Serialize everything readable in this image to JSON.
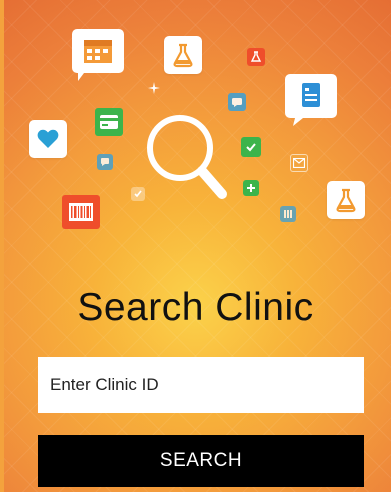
{
  "screen": {
    "title": "Search Clinic",
    "clinic_id_field": {
      "placeholder": "Enter Clinic ID",
      "value": ""
    },
    "search_button_label": "SEARCH"
  },
  "decor_icons": [
    "calendar-icon",
    "flask-icon",
    "document-icon",
    "heart-icon",
    "card-icon",
    "magnifier-icon",
    "barcode-icon",
    "chat-icon",
    "check-icon",
    "plus-icon",
    "mail-icon",
    "flask-icon-small",
    "sparkle-icon"
  ],
  "colors": {
    "background_center": "#fbd24a",
    "background_edge": "#e56e34",
    "button_bg": "#000000",
    "button_text": "#ffffff",
    "title_text": "#111111"
  }
}
